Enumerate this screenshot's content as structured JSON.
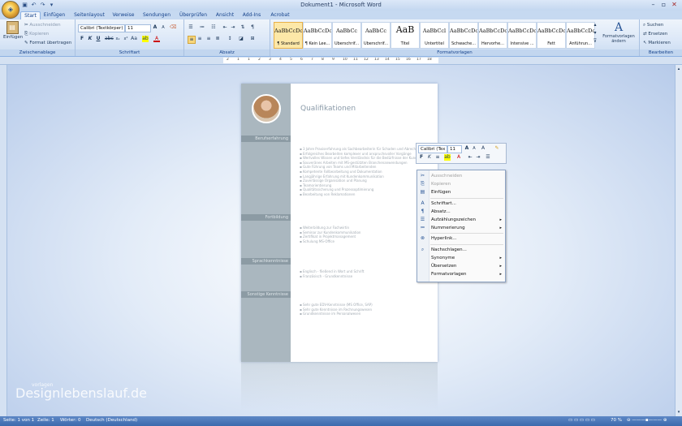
{
  "window": {
    "title": "Dokument1 - Microsoft Word"
  },
  "tabs": [
    "Start",
    "Einfügen",
    "Seitenlayout",
    "Verweise",
    "Sendungen",
    "Überprüfen",
    "Ansicht",
    "Add-Ins",
    "Acrobat"
  ],
  "ribbon": {
    "clipboard": {
      "paste": "Einfügen",
      "cut": "Ausschneiden",
      "copy": "Kopieren",
      "format_painter": "Format übertragen",
      "group_label": "Zwischenablage"
    },
    "font": {
      "font_name": "Calibri (Textkörper)",
      "font_size": "11",
      "group_label": "Schriftart"
    },
    "paragraph": {
      "group_label": "Absatz"
    },
    "styles": {
      "items": [
        {
          "preview": "AaBbCcDc",
          "name": "¶ Standard"
        },
        {
          "preview": "AaBbCcDc",
          "name": "¶ Kein Lee..."
        },
        {
          "preview": "AaBbCc",
          "name": "Überschrif..."
        },
        {
          "preview": "AaBbCc",
          "name": "Überschrif..."
        },
        {
          "preview": "AaB",
          "name": "Titel"
        },
        {
          "preview": "AaBbCcl",
          "name": "Untertitel"
        },
        {
          "preview": "AaBbCcDc",
          "name": "Schwache..."
        },
        {
          "preview": "AaBbCcDc",
          "name": "Hervorhe..."
        },
        {
          "preview": "AaBbCcDc",
          "name": "Intensive ..."
        },
        {
          "preview": "AaBbCcDc",
          "name": "Fett"
        },
        {
          "preview": "AaBbCcDc",
          "name": "Anführun..."
        }
      ],
      "change_styles": "Formatvorlagen ändern",
      "group_label": "Formatvorlagen"
    },
    "editing": {
      "find": "Suchen",
      "replace": "Ersetzen",
      "select": "Markieren",
      "group_label": "Bearbeiten"
    }
  },
  "ruler": {
    "ticks": [
      "2",
      "1",
      "1",
      "2",
      "3",
      "4",
      "5",
      "6",
      "7",
      "8",
      "9",
      "10",
      "11",
      "12",
      "13",
      "14",
      "15",
      "16",
      "17",
      "18"
    ]
  },
  "document": {
    "title": "Qualifikationen",
    "sections": [
      {
        "label": "Berufserfahrung",
        "bullets": [
          "3 Jahre Praxiserfahrung als Sachbearbeiterin für Schaden und Abrechnung",
          "Erfolgreiches Bearbeiten komplexer und anspruchsvoller Vorgänge",
          "Wertvolles Wissen und tiefes Verständnis für die Bedürfnisse der Kunden",
          "Souveränes Arbeiten mit MS-gestützten Branchenanwendungen",
          "Gute Führung von Teams und Mitarbeitenden",
          "Kompetente Fallbearbeitung und Dokumentation",
          "Langjährige Erfahrung mit Kundenkommunikation",
          "Zuverlässige Organisation und Planung",
          "Teamorientierung",
          "Qualitätssicherung und Prozessoptimierung",
          "Bearbeitung von Reklamationen"
        ]
      },
      {
        "label": "Fortbildung",
        "bullets": [
          "Weiterbildung zur Fachwirtin",
          "Seminar zur Kundenkommunikation",
          "Zertifikat in Projektmanagement",
          "Schulung MS-Office"
        ]
      },
      {
        "label": "Sprachkenntnisse",
        "bullets": [
          "Englisch - fließend in Wort und Schrift",
          "Französisch - Grundkenntnisse"
        ]
      },
      {
        "label": "Sonstige Kenntnisse",
        "bullets": [
          "Sehr gute EDV-Kenntnisse (MS Office, SAP)",
          "Sehr gute Kenntnisse im Rechnungswesen",
          "Grundkenntnisse im Personalwesen"
        ]
      }
    ]
  },
  "mini_toolbar": {
    "font_name": "Calibri (Tex",
    "font_size": "11"
  },
  "context_menu": {
    "items": [
      {
        "label": "Ausschneiden",
        "icon": "scissors-icon",
        "disabled": true
      },
      {
        "label": "Kopieren",
        "icon": "copy-icon",
        "disabled": true
      },
      {
        "label": "Einfügen",
        "icon": "paste-icon"
      },
      {
        "label": "Schriftart...",
        "icon": "font-icon"
      },
      {
        "label": "Absatz...",
        "icon": "paragraph-icon"
      },
      {
        "label": "Aufzählungszeichen",
        "icon": "bullets-icon",
        "submenu": true
      },
      {
        "label": "Nummerierung",
        "icon": "numbering-icon",
        "submenu": true
      },
      {
        "label": "Hyperlink...",
        "icon": "hyperlink-icon"
      },
      {
        "label": "Nachschlagen...",
        "icon": "research-icon"
      },
      {
        "label": "Synonyme",
        "submenu": true
      },
      {
        "label": "Übersetzen",
        "submenu": true
      },
      {
        "label": "Formatvorlagen",
        "submenu": true
      }
    ]
  },
  "watermark": {
    "small": "vorlagen",
    "large": "Designlebenslauf.de"
  },
  "statusbar": {
    "page": "Seite: 1 von 1",
    "line": "Zeile: 1",
    "words": "Wörter: 0",
    "language": "Deutsch (Deutschland)",
    "zoom": "70 %"
  }
}
